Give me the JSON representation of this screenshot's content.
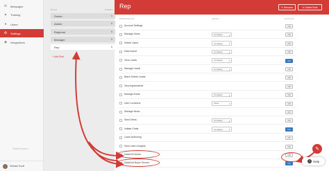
{
  "sidebar": {
    "items": [
      {
        "label": "Messages",
        "icon": "envelope-icon",
        "glyph": "✉"
      },
      {
        "label": "Training",
        "icon": "graduation-cap-icon",
        "glyph": "▲"
      },
      {
        "label": "Users",
        "icon": "users-icon",
        "glyph": "●"
      },
      {
        "label": "Settings",
        "icon": "gear-icon",
        "glyph": "⚙"
      },
      {
        "label": "Integrations",
        "icon": "puzzle-icon",
        "glyph": "◆"
      }
    ],
    "active": "Settings",
    "logo_text": "SalesScreen",
    "user_name": "Michael Scott"
  },
  "roles": {
    "col_role": "ROLE",
    "col_users": "USERS",
    "items": [
      {
        "name": "Owner",
        "count": "1"
      },
      {
        "name": "Admin",
        "count": "0"
      },
      {
        "name": "Regional",
        "count": "0"
      },
      {
        "name": "Manager",
        "count": "0"
      },
      {
        "name": "Rep",
        "count": "0"
      }
    ],
    "selected": "Rep",
    "add_label": "+ Add Role"
  },
  "header": {
    "title": "Rep",
    "rename_label": "✎ Rename",
    "delete_label": "✕ Delete Role"
  },
  "table": {
    "col_permission": "PERMISSION",
    "col_level": "LEVEL",
    "col_status": "STATUS",
    "rows": [
      {
        "label": "Account Settings",
        "level": "",
        "status": "Off"
      },
      {
        "label": "Manage Users",
        "level": "Company",
        "status": "Off"
      },
      {
        "label": "Delete Users",
        "level": "Company",
        "status": "Off"
      },
      {
        "label": "Data Import",
        "level": "Company",
        "status": "Off"
      },
      {
        "label": "View Leads",
        "level": "Company",
        "status": "On"
      },
      {
        "label": "Manage Leads",
        "level": "Company",
        "status": "Off"
      },
      {
        "label": "Batch Delete Leads",
        "level": "",
        "status": "Off"
      },
      {
        "label": "View Agreements",
        "level": "",
        "status": "Off"
      },
      {
        "label": "Manage Areas",
        "level": "Company",
        "status": "Off"
      },
      {
        "label": "User Locations",
        "level": "Team",
        "status": "Off"
      },
      {
        "label": "Manage News",
        "level": "",
        "status": "Off"
      },
      {
        "label": "Send News",
        "level": "Company",
        "status": "Off"
      },
      {
        "label": "Initiate Chats",
        "level": "Company",
        "status": "On"
      },
      {
        "label": "Learn Authoring",
        "level": "",
        "status": "Off"
      },
      {
        "label": "View Learn Insights",
        "level": "",
        "status": "Off"
      },
      {
        "label": "DataGrid Areas",
        "level": "",
        "status": "Off"
      },
      {
        "label": "DataGrid Buyer Scores",
        "level": "",
        "status": "On"
      }
    ]
  },
  "help": {
    "label": "Help"
  },
  "colors": {
    "accent": "#d23b36",
    "toggle_on": "#3a79bb"
  }
}
